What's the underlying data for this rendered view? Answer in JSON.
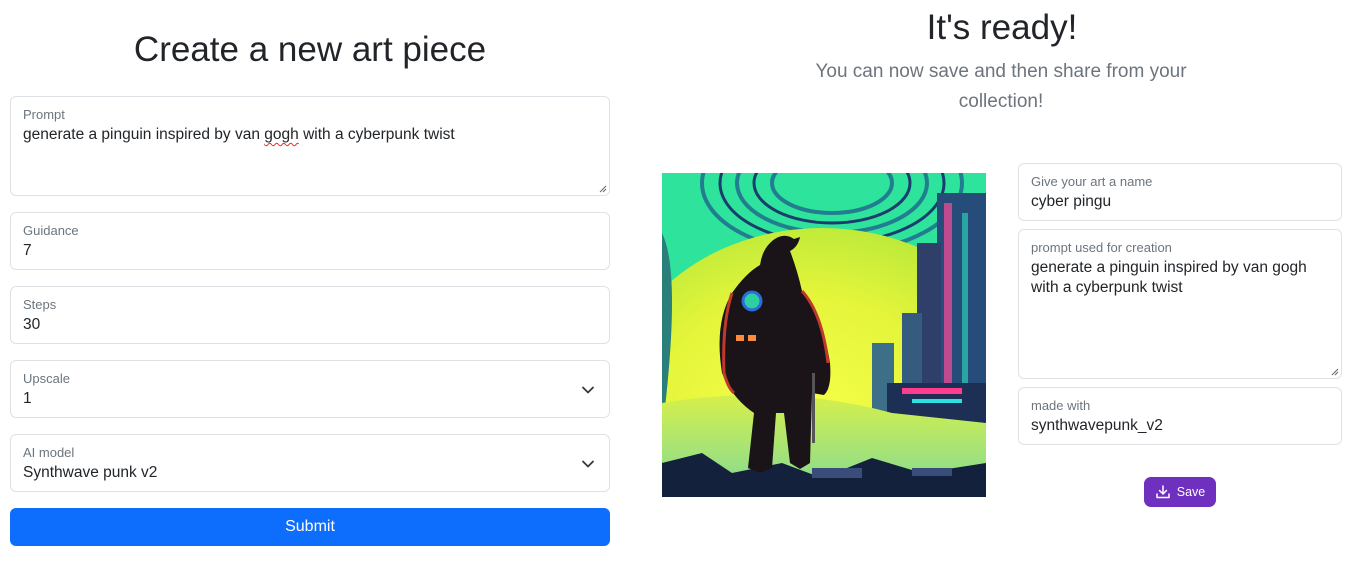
{
  "form": {
    "title": "Create a new art piece",
    "prompt": {
      "label": "Prompt",
      "value_before": "generate a pinguin inspired by van ",
      "value_typo": "gogh",
      "value_after": " with a cyberpunk twist"
    },
    "guidance": {
      "label": "Guidance",
      "value": "7"
    },
    "steps": {
      "label": "Steps",
      "value": "30"
    },
    "upscale": {
      "label": "Upscale",
      "value": "1"
    },
    "ai_model": {
      "label": "AI model",
      "value": "Synthwave punk v2"
    },
    "submit_label": "Submit"
  },
  "result": {
    "title": "It's ready!",
    "subtitle": "You can now save and then share from your collection!",
    "name_field": {
      "label": "Give your art a name",
      "value": "cyber pingu"
    },
    "prompt_field": {
      "label": "prompt used for creation",
      "value": "generate a pinguin inspired by van gogh with a cyberpunk twist"
    },
    "model_field": {
      "label": "made with",
      "value": "synthwavepunk_v2"
    },
    "save_label": "Save",
    "image_alt": "cyberpunk penguin artwork"
  },
  "colors": {
    "primary": "#0d6efd",
    "save": "#6f2fbf",
    "sky": "#2de0a0",
    "glow": "#e9f53a"
  },
  "icons": {
    "select": "chevron-down-icon",
    "save": "download-icon"
  }
}
